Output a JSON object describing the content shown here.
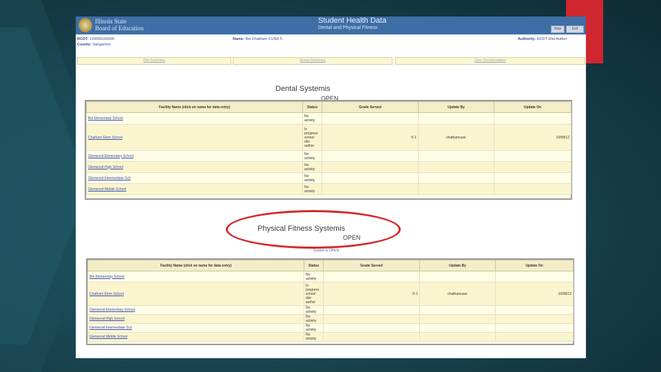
{
  "header": {
    "board_line1": "Illinois State",
    "board_line2": "Board of Education",
    "title": "Student Health Data",
    "subtitle": "Dental and Physical Fitness",
    "buttons": [
      "Help",
      "Exit"
    ]
  },
  "info": {
    "rcdt_label": "RCDT:",
    "rcdt_value": "110000160000",
    "name_label": "Name:",
    "name_value": "Bel Chatham CUSD 5",
    "county_label": "County:",
    "county_value": "Sangamon",
    "authority_label": "Authority:",
    "authority_value": "RCDT Dist Author"
  },
  "tabs": [
    "Dist Summary",
    "Dental Summary",
    "User Documentation"
  ],
  "columns": [
    "Facility Name (click on name for data entry)",
    "Status",
    "Grade Served",
    "Update By",
    "Update On"
  ],
  "dental": {
    "title": "Dental Systemis",
    "status": "OPEN",
    "rows": [
      {
        "facility": "Bel Elementary School",
        "status": "No activity",
        "grade": "",
        "by": "",
        "on": ""
      },
      {
        "facility": "Chatham Elem School",
        "status": "In progress school dist author",
        "grade": "K-1",
        "by": "chathamuser",
        "on": "10/08/12"
      },
      {
        "facility": "Glenwood Elementary School",
        "status": "No activity",
        "grade": "",
        "by": "",
        "on": ""
      },
      {
        "facility": "Glenwood High School",
        "status": "No activity",
        "grade": "",
        "by": "",
        "on": ""
      },
      {
        "facility": "Glenwood Intermediate Sch",
        "status": "No activity",
        "grade": "",
        "by": "",
        "on": ""
      },
      {
        "facility": "Glenwood Middle School",
        "status": "No activity",
        "grade": "",
        "by": "",
        "on": ""
      }
    ]
  },
  "fitness": {
    "title": "Physical Fitness Systemis",
    "status": "OPEN",
    "system_open": "System is OPEN",
    "rows": [
      {
        "facility": "Bel Elementary School",
        "status": "No activity",
        "grade": "",
        "by": "",
        "on": ""
      },
      {
        "facility": "Chatham Elem School",
        "status": "In progress school dist author",
        "grade": "K-1",
        "by": "chathamuser",
        "on": "10/08/12"
      },
      {
        "facility": "Glenwood Elementary School",
        "status": "No activity",
        "grade": "",
        "by": "",
        "on": ""
      },
      {
        "facility": "Glenwood High School",
        "status": "No activity",
        "grade": "",
        "by": "",
        "on": ""
      },
      {
        "facility": "Glenwood Intermediate Sch",
        "status": "No activity",
        "grade": "",
        "by": "",
        "on": ""
      },
      {
        "facility": "Glenwood Middle School",
        "status": "No activity",
        "grade": "",
        "by": "",
        "on": ""
      }
    ]
  },
  "colors": {
    "accent_red": "#d0262f",
    "header_blue": "#3d6ea6",
    "highlight_circle": "#d22a2a"
  }
}
